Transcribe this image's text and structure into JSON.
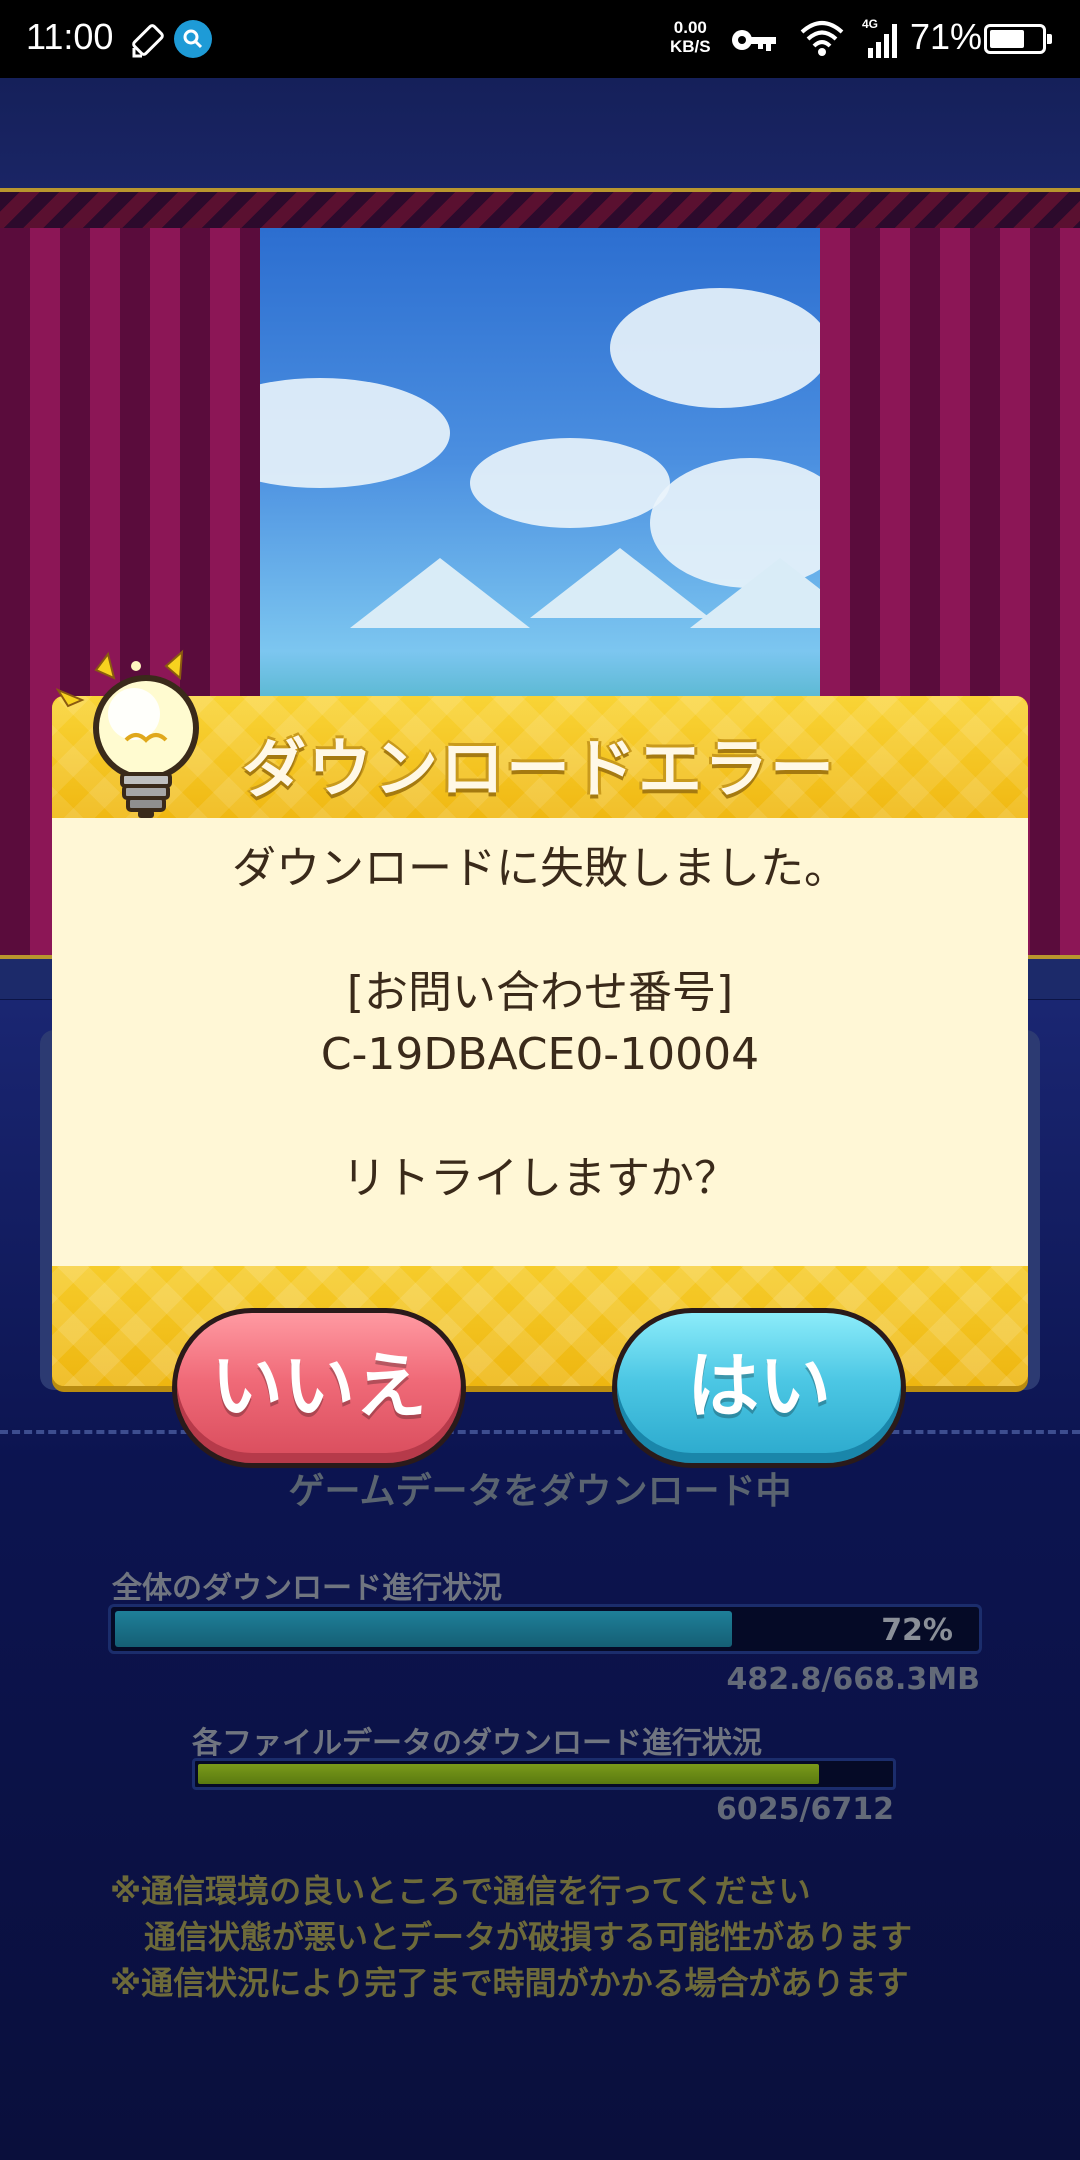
{
  "status_bar": {
    "time": "11:00",
    "net_speed_value": "0.00",
    "net_speed_unit": "KB/S",
    "network_type": "4G",
    "battery_percent": "71%",
    "battery_level": 0.71,
    "icons": [
      "auto-rotate-icon",
      "search-icon",
      "key-icon",
      "wifi-icon",
      "signal-icon",
      "battery-icon"
    ]
  },
  "dialog": {
    "title": "ダウンロードエラー",
    "message": "ダウンロードに失敗しました。",
    "inquiry_label": "[お問い合わせ番号]",
    "inquiry_code": "C-19DBACE0-10004",
    "question": "リトライしますか？",
    "no_label": "いいえ",
    "yes_label": "はい"
  },
  "download": {
    "title": "ゲームデータをダウンロード中",
    "overall_label": "全体のダウンロード進行状況",
    "overall_percent_text": "72%",
    "overall_progress": 0.72,
    "overall_size": "482.8/668.3MB",
    "file_label": "各ファイルデータのダウンロード進行状況",
    "file_count": "6025/6712",
    "file_progress": 0.8977
  },
  "notes": [
    "※通信環境の良いところで通信を行ってください",
    "通信状態が悪いとデータが破損する可能性があります",
    "※通信状況により完了まで時間がかかる場合があります"
  ],
  "colors": {
    "dialog_yellow": "#f5c51e",
    "dialog_body": "#fff7d6",
    "no_button": "#f06a78",
    "yes_button": "#4cc7e4",
    "overall_bar": "#1e7f99",
    "file_bar": "#7a9a1a"
  }
}
